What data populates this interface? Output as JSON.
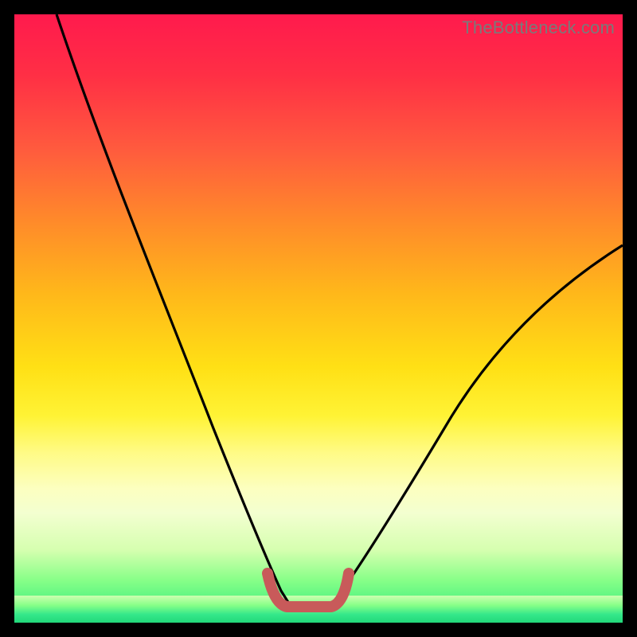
{
  "watermark": "TheBottleneck.com",
  "chart_data": {
    "type": "line",
    "title": "",
    "xlabel": "",
    "ylabel": "",
    "xlim": [
      0,
      100
    ],
    "ylim": [
      0,
      100
    ],
    "series": [
      {
        "name": "bottleneck-curve-left",
        "x": [
          7,
          12,
          18,
          24,
          30,
          35,
          40,
          43,
          45
        ],
        "y": [
          100,
          82,
          62,
          44,
          28,
          16,
          7,
          3,
          2
        ]
      },
      {
        "name": "bottleneck-curve-right",
        "x": [
          52,
          55,
          60,
          68,
          78,
          88,
          100
        ],
        "y": [
          2,
          4,
          10,
          22,
          36,
          48,
          62
        ]
      },
      {
        "name": "target-range-marker",
        "x": [
          42,
          43,
          51,
          52
        ],
        "y": [
          6,
          2,
          2,
          6
        ]
      }
    ],
    "annotations": []
  },
  "colors": {
    "curve": "#000000",
    "marker": "#c85a5a",
    "background_top": "#ff1a4d",
    "background_bottom": "#22d87a"
  }
}
